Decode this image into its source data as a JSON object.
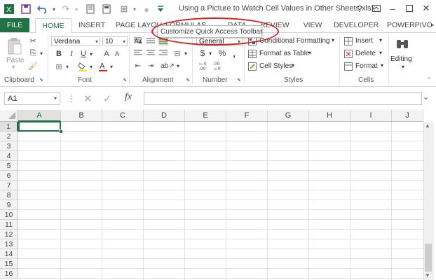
{
  "app": {
    "title": "Using a Picture to Watch Cell Values in Other Sheets.xlsx...",
    "help": "?"
  },
  "tabs": [
    "FILE",
    "HOME",
    "INSERT",
    "PAGE LAYOU",
    "FORMULAS",
    "DATA",
    "REVIEW",
    "VIEW",
    "DEVELOPER",
    "POWERPIVO"
  ],
  "tooltip": "Customize Quick Access Toolbar",
  "ribbon": {
    "clipboard": {
      "label": "Clipboard",
      "paste": "Paste"
    },
    "font": {
      "label": "Font",
      "name": "Verdana",
      "size": "10",
      "bold": "B",
      "italic": "I",
      "underline": "U"
    },
    "alignment": {
      "label": "Alignment"
    },
    "number": {
      "label": "Number",
      "format": "General",
      "currency": "$",
      "percent": "%",
      "comma": ","
    },
    "styles": {
      "label": "Styles",
      "conditional": "Conditional Formatting",
      "format_table": "Format as Table",
      "cell_styles": "Cell Styles"
    },
    "cells": {
      "label": "Cells",
      "insert": "Insert",
      "delete": "Delete",
      "format": "Format"
    },
    "editing": {
      "label": "Editing"
    }
  },
  "formula_bar": {
    "name_box": "A1",
    "fx": "fx",
    "value": ""
  },
  "columns": [
    "A",
    "B",
    "C",
    "D",
    "E",
    "F",
    "G",
    "H",
    "I",
    "J"
  ],
  "rows": [
    "1",
    "2",
    "3",
    "4",
    "5",
    "6",
    "7",
    "8",
    "9",
    "10",
    "11",
    "12",
    "13",
    "14",
    "15",
    "16"
  ],
  "colors": {
    "accent": "#217346",
    "highlight": "#d71f1f"
  }
}
